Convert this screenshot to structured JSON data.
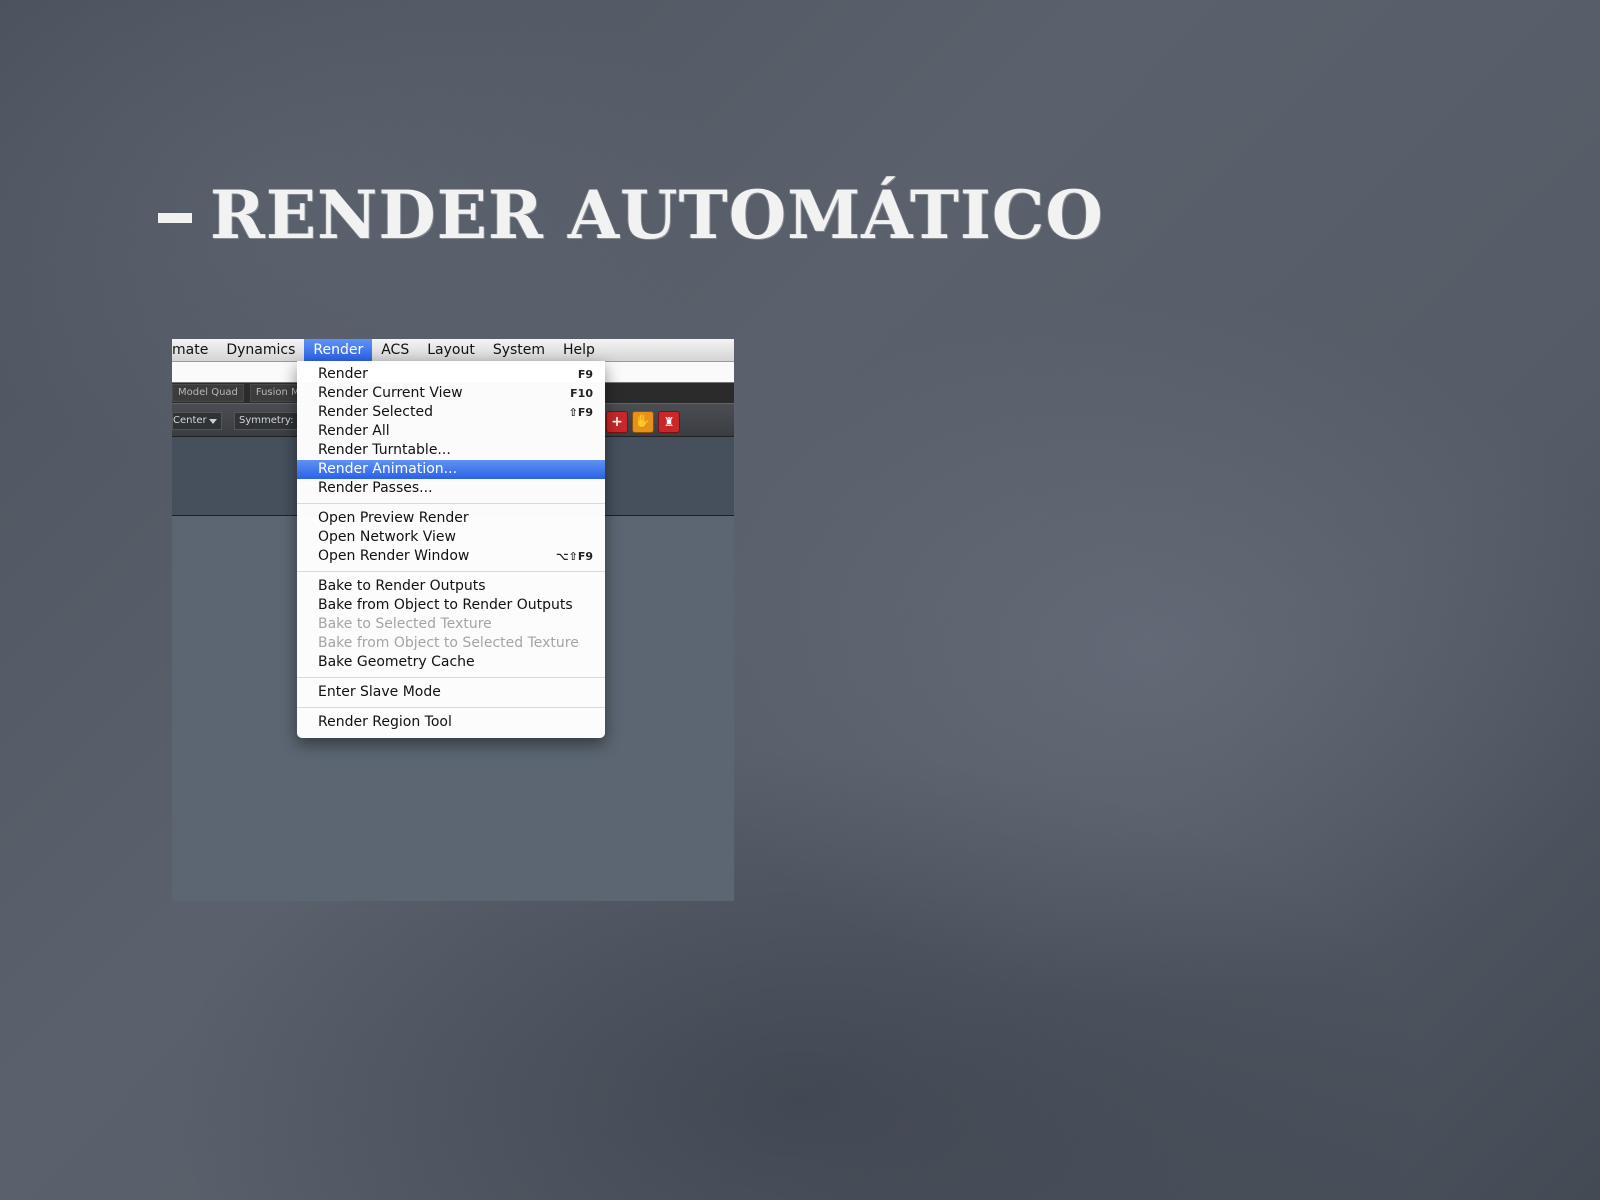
{
  "slide": {
    "title": "Render Automático"
  },
  "menubar": {
    "items": [
      "mate",
      "Dynamics",
      "Render",
      "ACS",
      "Layout",
      "System",
      "Help"
    ],
    "active": "Render"
  },
  "tabs": [
    "Model Quad",
    "Fusion Mo"
  ],
  "toolbar": {
    "center_label": "Center",
    "symmetry_label": "Symmetry: O"
  },
  "icons": {
    "add": "plus-icon",
    "hand": "hand-icon",
    "castle": "castle-icon"
  },
  "render_menu": {
    "groups": [
      [
        {
          "label": "Render",
          "shortcut": "F9"
        },
        {
          "label": "Render Current View",
          "shortcut": "F10"
        },
        {
          "label": "Render Selected",
          "shortcut": "⇧F9"
        },
        {
          "label": "Render All",
          "shortcut": ""
        },
        {
          "label": "Render Turntable...",
          "shortcut": ""
        },
        {
          "label": "Render Animation...",
          "shortcut": "",
          "selected": true
        },
        {
          "label": "Render Passes...",
          "shortcut": ""
        }
      ],
      [
        {
          "label": "Open Preview Render",
          "shortcut": ""
        },
        {
          "label": "Open Network View",
          "shortcut": ""
        },
        {
          "label": "Open Render Window",
          "shortcut": "⌥⇧F9"
        }
      ],
      [
        {
          "label": "Bake to Render Outputs",
          "shortcut": ""
        },
        {
          "label": "Bake from Object to Render Outputs",
          "shortcut": ""
        },
        {
          "label": "Bake to Selected Texture",
          "shortcut": "",
          "disabled": true
        },
        {
          "label": "Bake from Object to Selected Texture",
          "shortcut": "",
          "disabled": true
        },
        {
          "label": "Bake Geometry Cache",
          "shortcut": ""
        }
      ],
      [
        {
          "label": "Enter Slave Mode",
          "shortcut": ""
        }
      ],
      [
        {
          "label": "Render Region Tool",
          "shortcut": ""
        }
      ]
    ]
  },
  "colors": {
    "highlight": "#2b62e6",
    "chalkboard": "#555c67"
  }
}
